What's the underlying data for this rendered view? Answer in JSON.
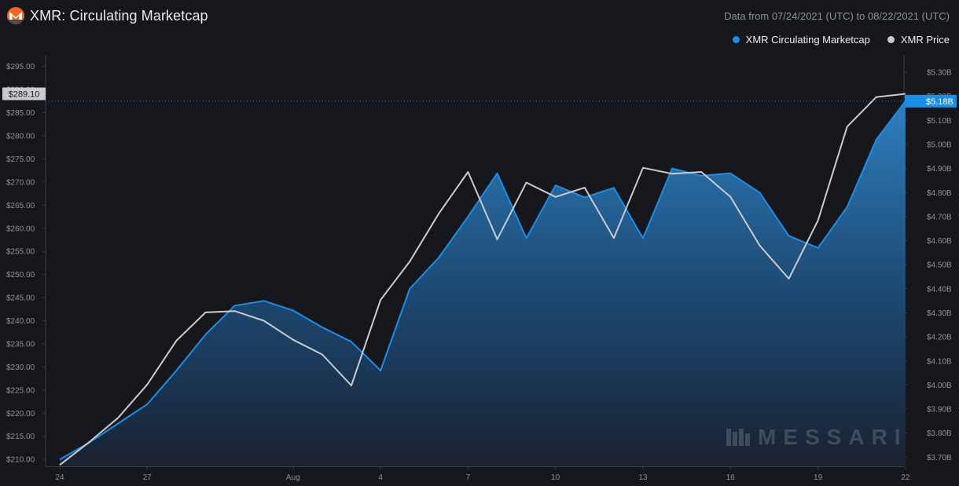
{
  "header": {
    "title": "XMR: Circulating Marketcap",
    "date_range": "Data from 07/24/2021 (UTC) to 08/22/2021 (UTC)",
    "logo_icon": "monero-logo-icon"
  },
  "watermark": {
    "text": "MESSARI",
    "icon": "messari-logo-icon"
  },
  "colors": {
    "background": "#16171c",
    "marketcap": "#1c8ee6",
    "price": "#c9cbd1",
    "logo": "#f26822"
  },
  "chart_data": {
    "type": "area",
    "x_ticks": [
      "24",
      "27",
      "Aug",
      "4",
      "7",
      "10",
      "13",
      "16",
      "19",
      "22"
    ],
    "x_tick_days": [
      0,
      3,
      8,
      11,
      14,
      17,
      20,
      23,
      26,
      29
    ],
    "left_axis": {
      "ylim": [
        208.5,
        297.5
      ],
      "ticks": [
        "$210.00",
        "$215.00",
        "$220.00",
        "$225.00",
        "$230.00",
        "$235.00",
        "$240.00",
        "$245.00",
        "$250.00",
        "$255.00",
        "$260.00",
        "$265.00",
        "$270.00",
        "$275.00",
        "$280.00",
        "$285.00",
        "$290.00",
        "$295.00"
      ],
      "tick_values": [
        210,
        215,
        220,
        225,
        230,
        235,
        240,
        245,
        250,
        255,
        260,
        265,
        270,
        275,
        280,
        285,
        290,
        295
      ],
      "current_label": "$289.10",
      "current_value": 289.1
    },
    "right_axis": {
      "ylim": [
        3.662,
        5.372
      ],
      "ticks": [
        "$3.70B",
        "$3.80B",
        "$3.90B",
        "$4.00B",
        "$4.10B",
        "$4.20B",
        "$4.30B",
        "$4.40B",
        "$4.50B",
        "$4.60B",
        "$4.70B",
        "$4.80B",
        "$4.90B",
        "$5.00B",
        "$5.10B",
        "$5.20B",
        "$5.30B"
      ],
      "tick_values": [
        3.7,
        3.8,
        3.9,
        4.0,
        4.1,
        4.2,
        4.3,
        4.4,
        4.5,
        4.6,
        4.7,
        4.8,
        4.9,
        5.0,
        5.1,
        5.2,
        5.3
      ],
      "current_label": "$5.18B",
      "current_value": 5.18
    },
    "series": [
      {
        "name": "XMR Circulating Marketcap",
        "axis": "right",
        "unit": "B",
        "values": [
          3.69,
          3.76,
          3.84,
          3.92,
          4.06,
          4.21,
          4.33,
          4.35,
          4.31,
          4.24,
          4.18,
          4.06,
          4.4,
          4.53,
          4.7,
          4.88,
          4.61,
          4.83,
          4.78,
          4.82,
          4.61,
          4.9,
          4.87,
          4.88,
          4.8,
          4.62,
          4.57,
          4.74,
          5.02,
          5.18
        ]
      },
      {
        "name": "XMR Price",
        "axis": "left",
        "values": [
          208.8,
          213.7,
          219.0,
          226.2,
          235.7,
          241.8,
          242.1,
          240.0,
          235.9,
          232.7,
          226.0,
          244.5,
          252.8,
          263.2,
          272.2,
          257.6,
          269.9,
          266.8,
          268.8,
          257.9,
          273.1,
          271.8,
          272.2,
          266.8,
          256.3,
          249.1,
          261.7,
          282.0,
          288.4,
          289.1
        ]
      }
    ]
  }
}
